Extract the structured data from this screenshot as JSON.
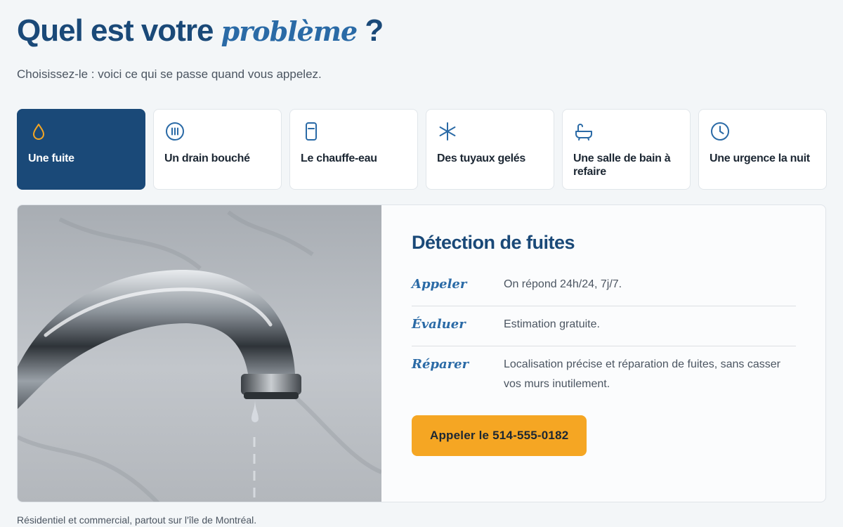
{
  "header": {
    "title_start": "Quel est votre",
    "title_accent": "problème",
    "title_end": "?",
    "subtitle": "Choisissez-le : voici ce qui se passe quand vous appelez."
  },
  "tabs": [
    {
      "label": "Une fuite",
      "icon": "drop-icon",
      "active": true
    },
    {
      "label": "Un drain bouché",
      "icon": "drain-icon",
      "active": false
    },
    {
      "label": "Le chauffe-eau",
      "icon": "water-heater-icon",
      "active": false
    },
    {
      "label": "Des tuyaux gelés",
      "icon": "snowflake-icon",
      "active": false
    },
    {
      "label": "Une salle de bain à refaire",
      "icon": "bathtub-icon",
      "active": false
    },
    {
      "label": "Une urgence la nuit",
      "icon": "clock-icon",
      "active": false
    }
  ],
  "panel": {
    "image": "dripping-faucet-photo",
    "title": "Détection de fuites",
    "steps": [
      {
        "name": "Appeler",
        "text": "On répond 24h/24, 7j/7."
      },
      {
        "name": "Évaluer",
        "text": "Estimation gratuite."
      },
      {
        "name": "Réparer",
        "text": "Localisation précise et réparation de fuites, sans casser vos murs inutilement."
      }
    ],
    "cta_label": "Appeler le 514-555-0182"
  },
  "footer": {
    "note": "Résidentiel et commercial, partout sur l'île de Montréal."
  },
  "colors": {
    "primary": "#1a4978",
    "accent": "#2a6aa6",
    "cta": "#f5a623",
    "active_icon": "#f5a623",
    "background": "#f3f6f8"
  }
}
